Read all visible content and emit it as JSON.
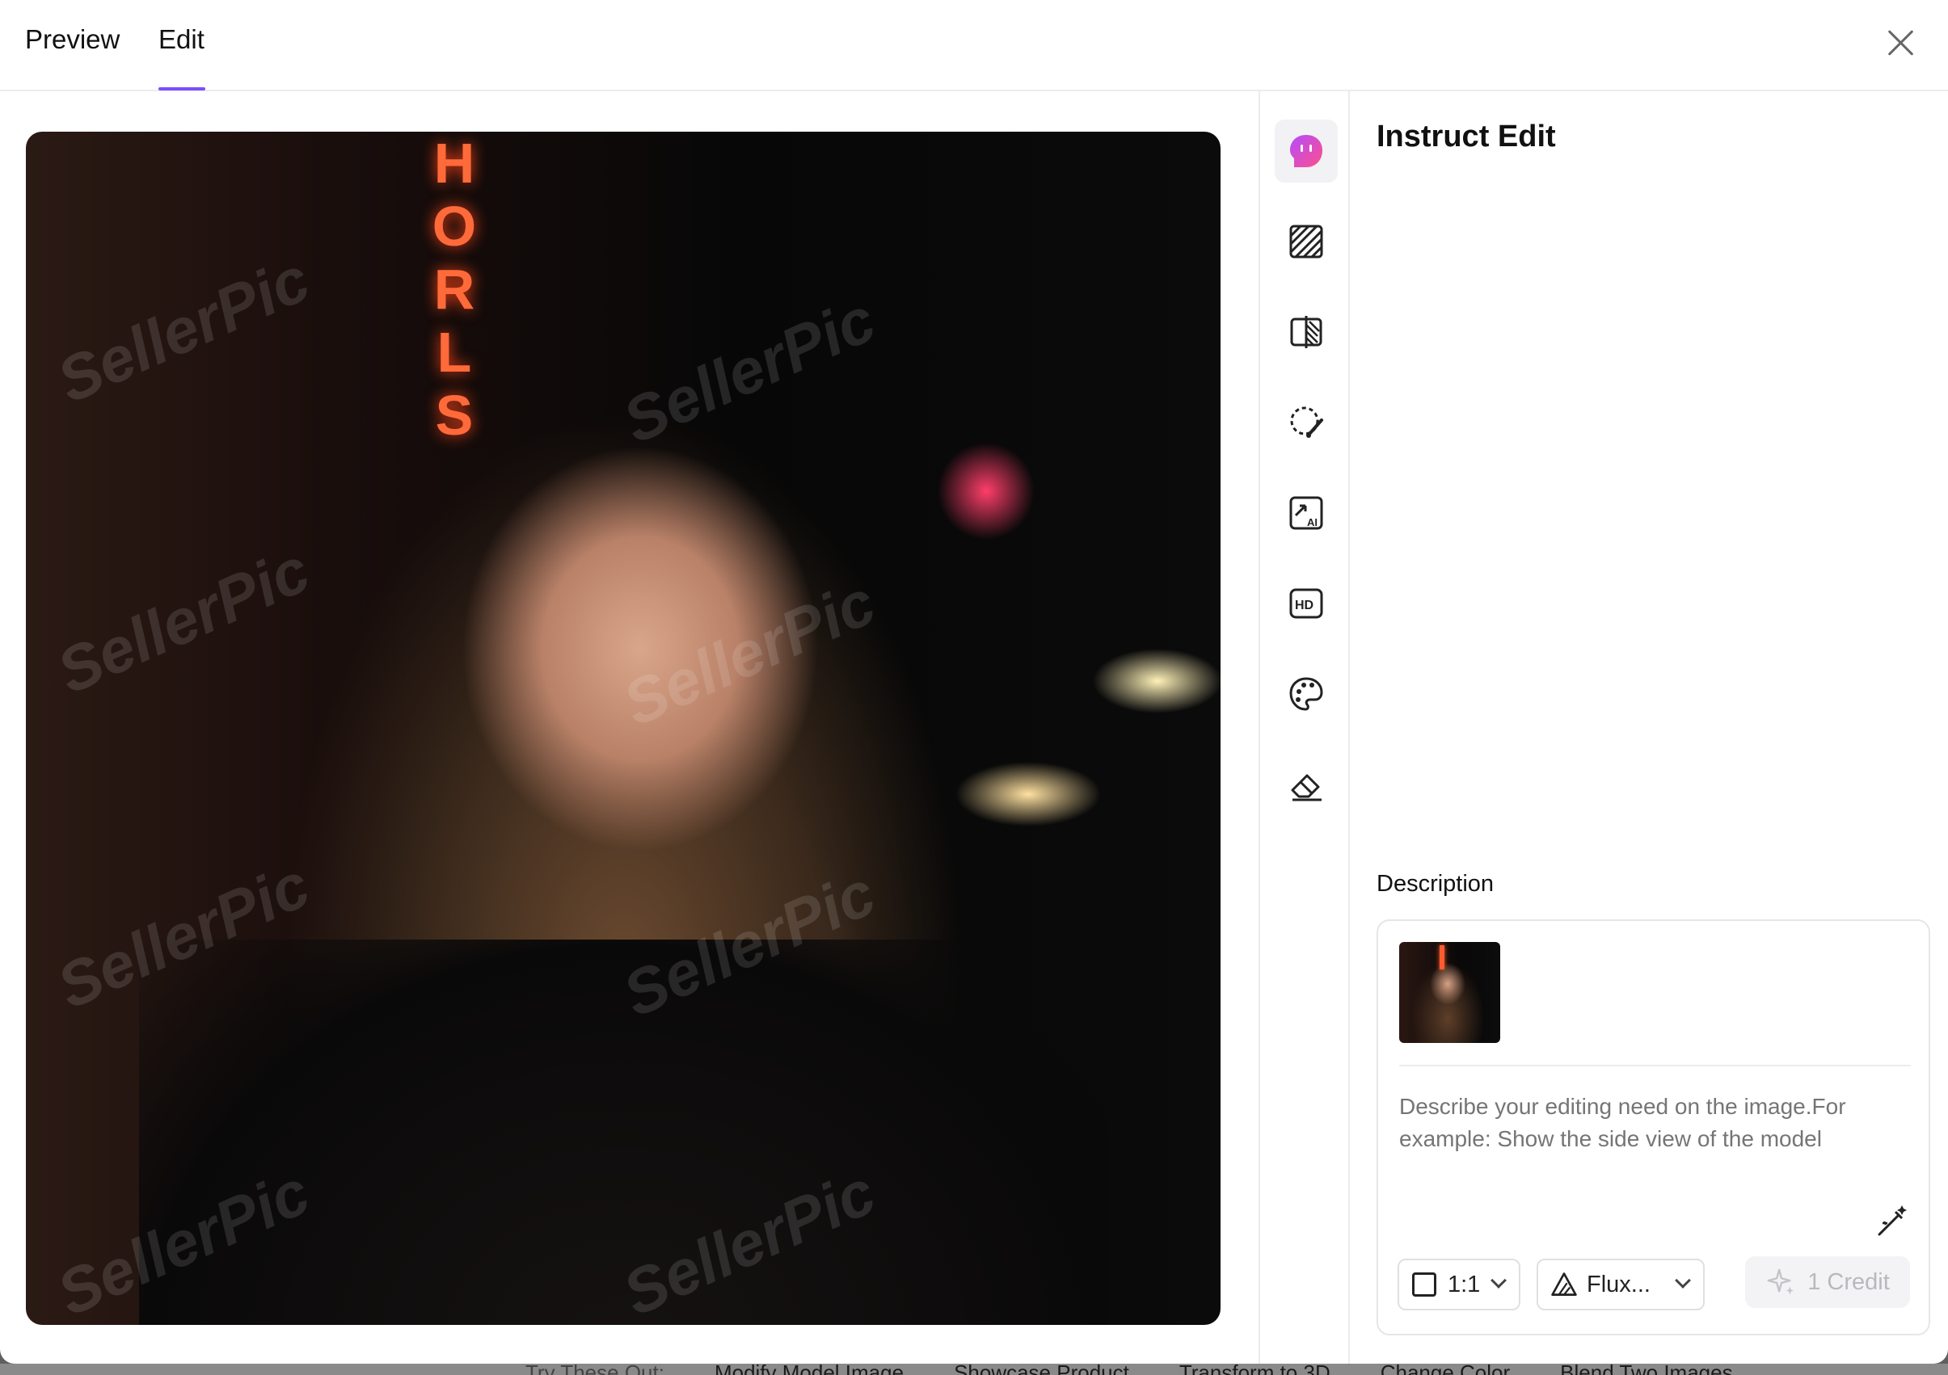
{
  "header": {
    "tabs": [
      {
        "label": "Preview",
        "active": false
      },
      {
        "label": "Edit",
        "active": true
      }
    ],
    "accent_color": "#7c4dff"
  },
  "image": {
    "neon_letters": [
      "H",
      "O",
      "R",
      "L",
      "S"
    ],
    "watermark": "SellerPic"
  },
  "tools": [
    {
      "icon": "instruct-edit-icon",
      "active": true
    },
    {
      "icon": "pattern-fill-icon",
      "active": false
    },
    {
      "icon": "compare-split-icon",
      "active": false
    },
    {
      "icon": "lasso-brush-icon",
      "active": false
    },
    {
      "icon": "ai-expand-icon",
      "active": false
    },
    {
      "icon": "hd-icon",
      "active": false
    },
    {
      "icon": "palette-icon",
      "active": false
    },
    {
      "icon": "eraser-icon",
      "active": false
    }
  ],
  "panel": {
    "title": "Instruct Edit",
    "description_label": "Description",
    "prompt_placeholder": "Describe your editing need on the image.For example: Show the side view of the model",
    "ratio_value": "1:1",
    "model_value": "Flux...",
    "credit_label": "1 Credit"
  },
  "background_strip": {
    "items": [
      "Try These Out:",
      "Modify Model Image",
      "Showcase Product",
      "Transform to 3D",
      "Change Color",
      "Blend Two Images"
    ]
  }
}
